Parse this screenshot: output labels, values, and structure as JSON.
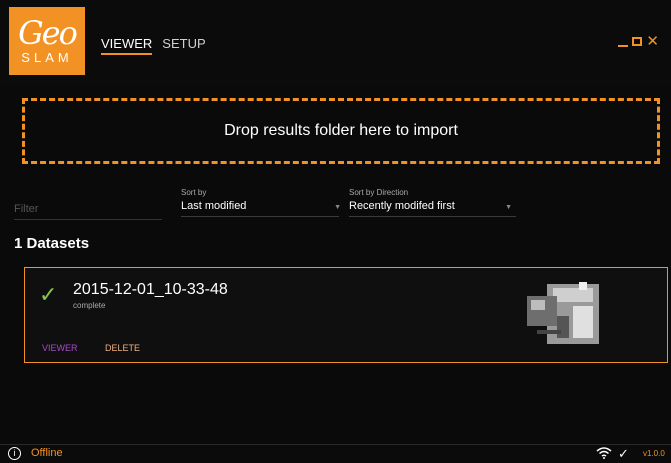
{
  "logo": {
    "line1": "Geo",
    "line2": "SLAM"
  },
  "nav": {
    "viewer": "VIEWER",
    "setup": "SETUP"
  },
  "window": {
    "minimize": "–",
    "close": "✕"
  },
  "dropzone": {
    "text": "Drop results folder here to import"
  },
  "filter": {
    "placeholder": "Filter"
  },
  "sort_by": {
    "label": "Sort by",
    "value": "Last modified"
  },
  "sort_direction": {
    "label": "Sort by Direction",
    "value": "Recently modifed first"
  },
  "datasets": {
    "title": "1 Datasets"
  },
  "dataset": {
    "name": "2015-12-01_10-33-48",
    "status": "complete",
    "viewer": "VIEWER",
    "delete": "DELETE"
  },
  "statusbar": {
    "info_icon": "i",
    "connection": "Offline",
    "version": "v1.0.0",
    "wifi_icon": "wifi-icon",
    "check_icon": "check-icon"
  },
  "colors": {
    "accent": "#f39224",
    "success": "#8bc34a",
    "viewer_link": "#a64cc8"
  }
}
